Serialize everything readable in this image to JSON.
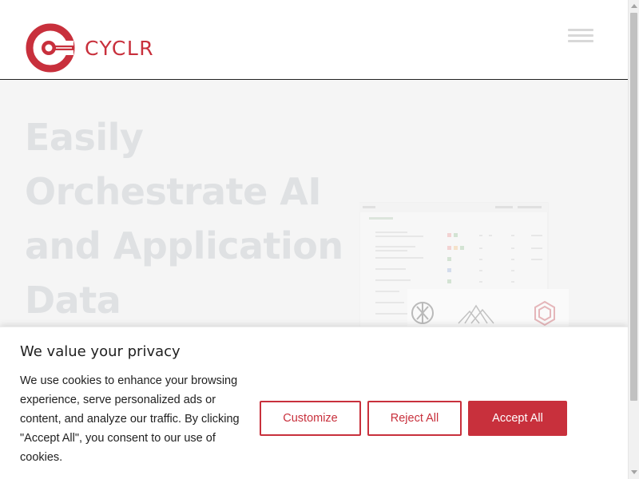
{
  "brand": {
    "name": "CYCLR",
    "accent_color": "#c8303c"
  },
  "header": {
    "menu_icon": "hamburger-menu-icon"
  },
  "hero": {
    "title_lines": [
      "Easily",
      "Orchestrate AI",
      "and Application",
      "Data"
    ],
    "image_icons": [
      "openai-icon",
      "mountains-icon",
      "cyclr-hex-icon"
    ]
  },
  "cookie_banner": {
    "title": "We value your privacy",
    "text": "We use cookies to enhance your browsing experience, serve personalized ads or content, and analyze our traffic. By clicking \"Accept All\", you consent to our use of cookies.",
    "buttons": {
      "customize": "Customize",
      "reject": "Reject All",
      "accept": "Accept All"
    }
  }
}
